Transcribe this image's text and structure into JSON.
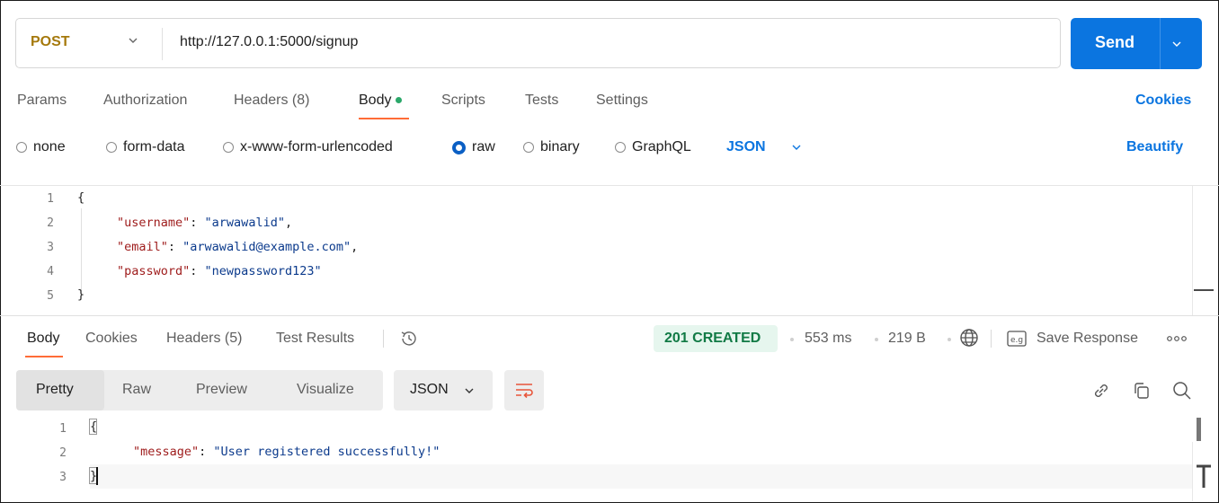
{
  "request": {
    "method": "POST",
    "url": "http://127.0.0.1:5000/signup",
    "send_label": "Send"
  },
  "request_tabs": [
    "Params",
    "Authorization",
    "Headers (8)",
    "Body",
    "Scripts",
    "Tests",
    "Settings"
  ],
  "cookies_link": "Cookies",
  "body_types": [
    "none",
    "form-data",
    "x-www-form-urlencoded",
    "raw",
    "binary",
    "GraphQL"
  ],
  "selected_body_type": "raw",
  "format": "JSON",
  "beautify_label": "Beautify",
  "request_body": {
    "line_numbers": [
      "1",
      "2",
      "3",
      "4",
      "5"
    ],
    "open": "{",
    "close": "}",
    "fields": [
      {
        "key": "\"username\"",
        "value": "\"arwawalid\"",
        "trail": ","
      },
      {
        "key": "\"email\"",
        "value": "\"arwawalid@example.com\"",
        "trail": ","
      },
      {
        "key": "\"password\"",
        "value": "\"newpassword123\"",
        "trail": ""
      }
    ]
  },
  "response_tabs": [
    "Body",
    "Cookies",
    "Headers (5)",
    "Test Results"
  ],
  "response_meta": {
    "status": "201 CREATED",
    "time": "553 ms",
    "size": "219 B",
    "save_label": "Save Response"
  },
  "view_modes": [
    "Pretty",
    "Raw",
    "Preview",
    "Visualize"
  ],
  "response_format": "JSON",
  "response_body": {
    "line_numbers": [
      "1",
      "2",
      "3"
    ],
    "open": "{",
    "close": "}",
    "key": "\"message\"",
    "value": "\"User registered successfully!\""
  },
  "colors": {
    "accent_blue": "#0b75e0",
    "method_color": "#a5790c",
    "status_green": "#117a45",
    "active_tab_underline": "#ff6c37"
  }
}
